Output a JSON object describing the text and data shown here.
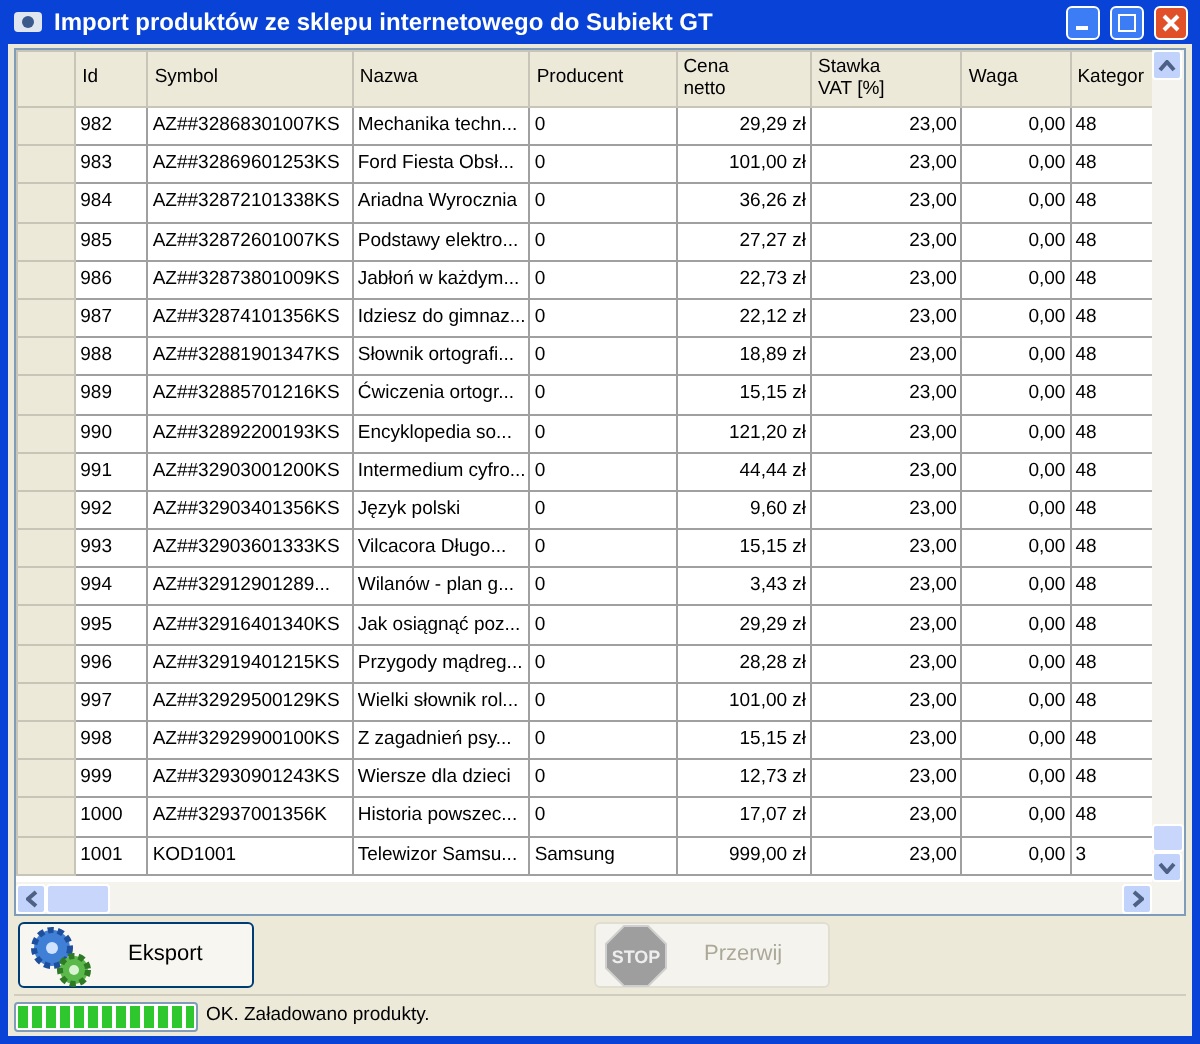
{
  "window": {
    "title": "Import produktów ze sklepu internetowego do Subiekt GT"
  },
  "table": {
    "columns": [
      "Id",
      "Symbol",
      "Nazwa",
      "Producent",
      "Cena netto",
      "Stawka VAT [%]",
      "Waga",
      "Kategor"
    ],
    "rows": [
      [
        "982",
        "AZ##32868301007KS",
        "Mechanika techn...",
        "0",
        "29,29 zł",
        "23,00",
        "0,00",
        "48"
      ],
      [
        "983",
        "AZ##32869601253KS",
        "Ford Fiesta Obsł...",
        "0",
        "101,00 zł",
        "23,00",
        "0,00",
        "48"
      ],
      [
        "984",
        "AZ##32872101338KS",
        "Ariadna Wyrocznia",
        "0",
        "36,26 zł",
        "23,00",
        "0,00",
        "48"
      ],
      [
        "985",
        "AZ##32872601007KS",
        "Podstawy elektro...",
        "0",
        "27,27 zł",
        "23,00",
        "0,00",
        "48"
      ],
      [
        "986",
        "AZ##32873801009KS",
        "Jabłoń w każdym...",
        "0",
        "22,73 zł",
        "23,00",
        "0,00",
        "48"
      ],
      [
        "987",
        "AZ##32874101356KS",
        "Idziesz do gimnaz...",
        "0",
        "22,12 zł",
        "23,00",
        "0,00",
        "48"
      ],
      [
        "988",
        "AZ##32881901347KS",
        "Słownik ortografi...",
        "0",
        "18,89 zł",
        "23,00",
        "0,00",
        "48"
      ],
      [
        "989",
        "AZ##32885701216KS",
        "Ćwiczenia ortogr...",
        "0",
        "15,15 zł",
        "23,00",
        "0,00",
        "48"
      ],
      [
        "990",
        "AZ##32892200193KS",
        "Encyklopedia so...",
        "0",
        "121,20 zł",
        "23,00",
        "0,00",
        "48"
      ],
      [
        "991",
        "AZ##32903001200KS",
        "Intermedium cyfro...",
        "0",
        "44,44 zł",
        "23,00",
        "0,00",
        "48"
      ],
      [
        "992",
        "AZ##32903401356KS",
        "Język polski",
        "0",
        "9,60 zł",
        "23,00",
        "0,00",
        "48"
      ],
      [
        "993",
        "AZ##32903601333KS",
        "Vilcacora Długo...",
        "0",
        "15,15 zł",
        "23,00",
        "0,00",
        "48"
      ],
      [
        "994",
        "AZ##32912901289...",
        "Wilanów - plan g...",
        "0",
        "3,43 zł",
        "23,00",
        "0,00",
        "48"
      ],
      [
        "995",
        "AZ##32916401340KS",
        "Jak osiągnąć poz...",
        "0",
        "29,29 zł",
        "23,00",
        "0,00",
        "48"
      ],
      [
        "996",
        "AZ##32919401215KS",
        "Przygody mądreg...",
        "0",
        "28,28 zł",
        "23,00",
        "0,00",
        "48"
      ],
      [
        "997",
        "AZ##32929500129KS",
        "Wielki słownik rol...",
        "0",
        "101,00 zł",
        "23,00",
        "0,00",
        "48"
      ],
      [
        "998",
        "AZ##32929900100KS",
        "Z zagadnień psy...",
        "0",
        "15,15 zł",
        "23,00",
        "0,00",
        "48"
      ],
      [
        "999",
        "AZ##32930901243KS",
        "Wiersze dla dzieci",
        "0",
        "12,73 zł",
        "23,00",
        "0,00",
        "48"
      ],
      [
        "1000",
        "AZ##32937001356K",
        "Historia powszec...",
        "0",
        "17,07 zł",
        "23,00",
        "0,00",
        "48"
      ],
      [
        "1001",
        "KOD1001",
        "Telewizor Samsu...",
        "Samsung",
        "999,00 zł",
        "23,00",
        "0,00",
        "3"
      ]
    ]
  },
  "buttons": [
    {
      "label": "Eksport",
      "disabled": false,
      "kind": "export"
    },
    {
      "label": "Przerwij",
      "disabled": true,
      "kind": "cancel",
      "icon_text": "STOP"
    }
  ],
  "status_bar": {
    "progress": {
      "level": 1.0
    },
    "message": "OK. Załadowano produkty."
  }
}
